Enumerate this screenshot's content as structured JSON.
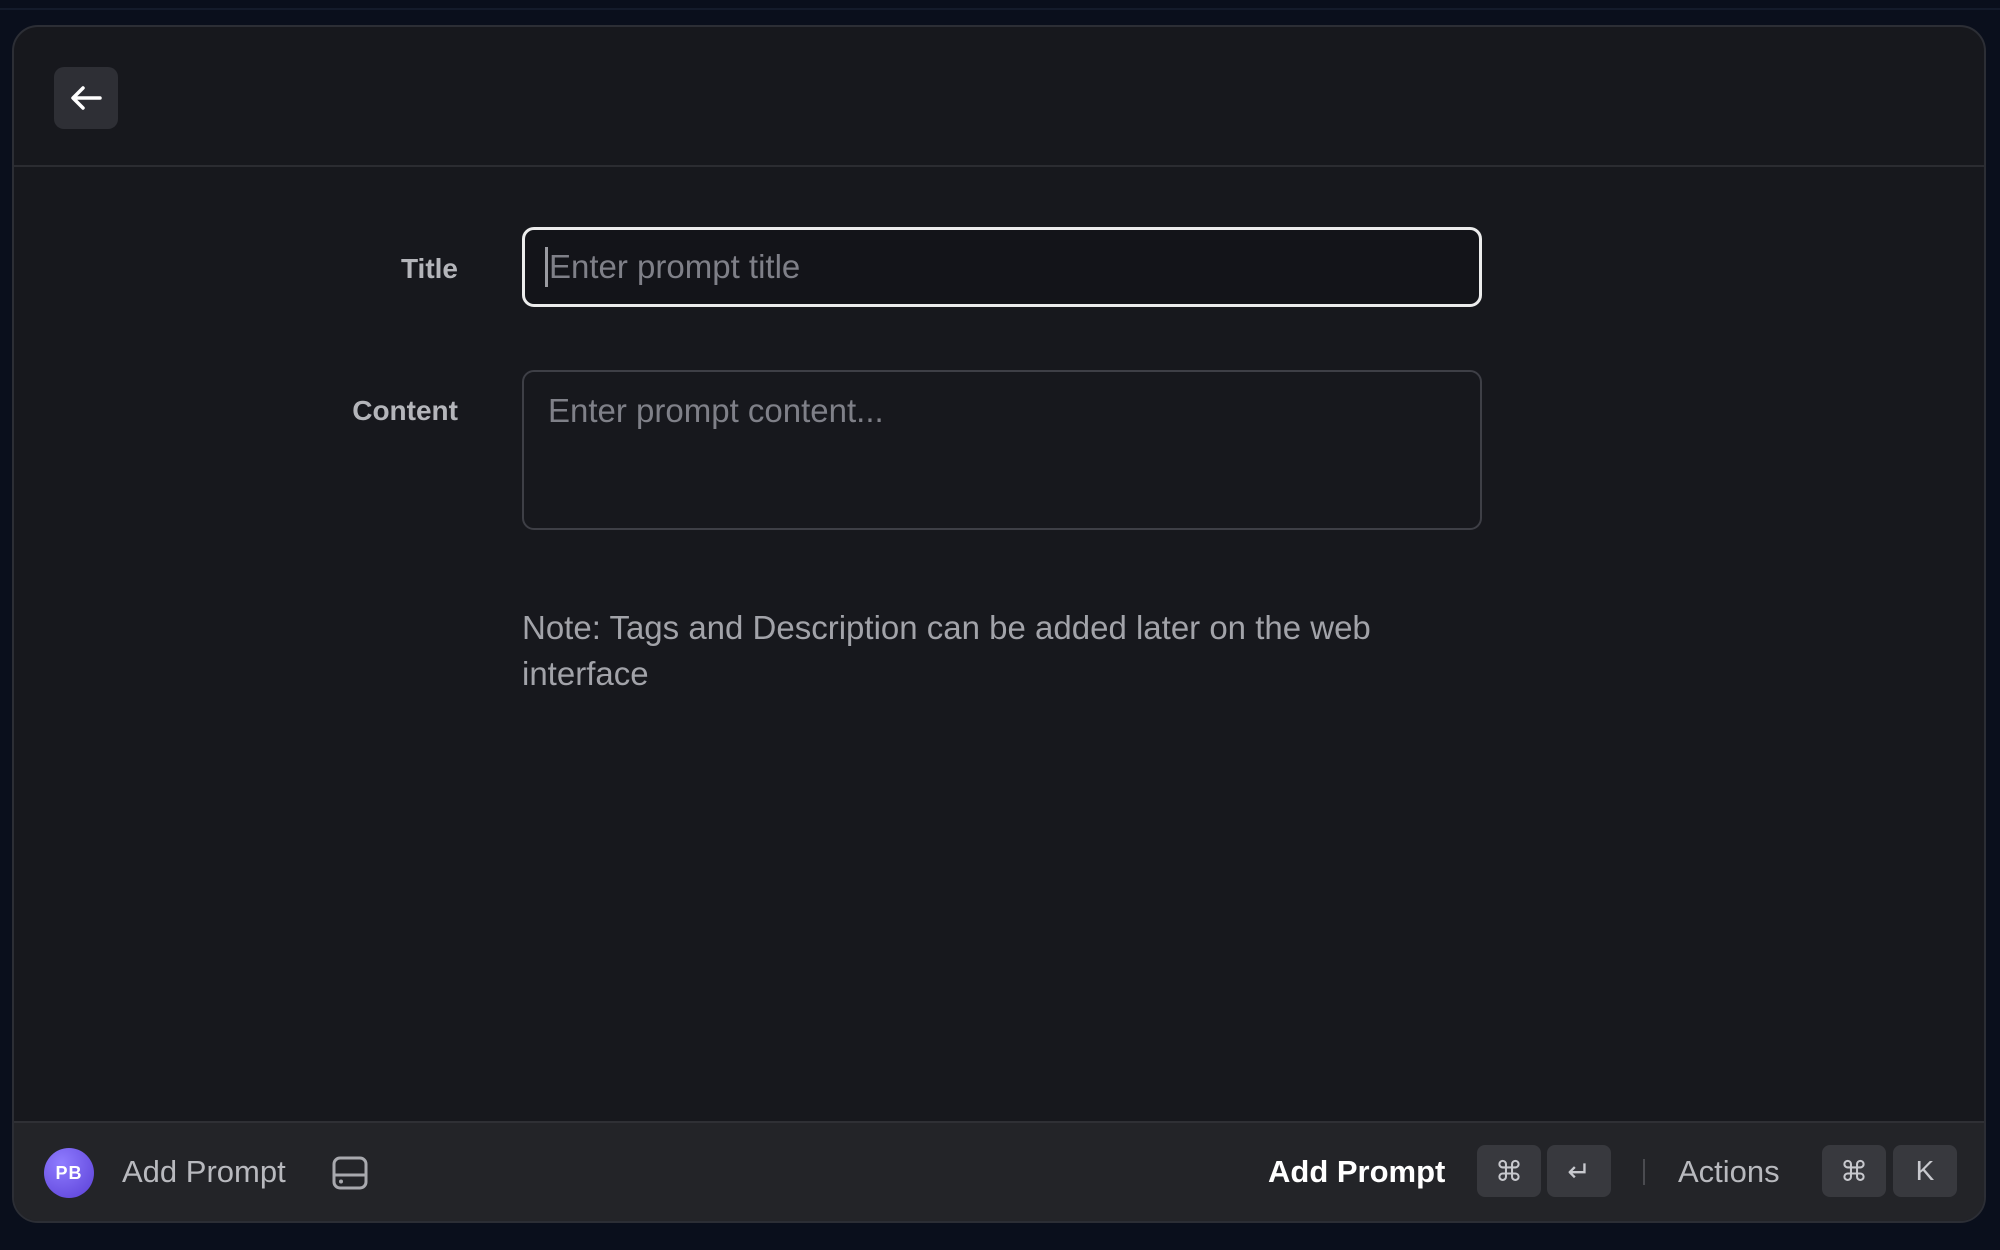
{
  "form": {
    "title_label": "Title",
    "title_placeholder": "Enter prompt title",
    "title_value": "",
    "content_label": "Content",
    "content_placeholder": "Enter prompt content...",
    "content_value": "",
    "note": "Note: Tags and Description can be added later on the web interface"
  },
  "header": {
    "back_icon": "arrow-left-icon"
  },
  "footer": {
    "avatar_initials": "PB",
    "avatar_color": "#6b4ff0",
    "title": "Add Prompt",
    "storage_icon": "hard-drive-icon",
    "primary_action": "Add Prompt",
    "primary_shortcut": [
      "⌘",
      "↵"
    ],
    "actions_label": "Actions",
    "actions_shortcut": [
      "⌘",
      "K"
    ]
  }
}
